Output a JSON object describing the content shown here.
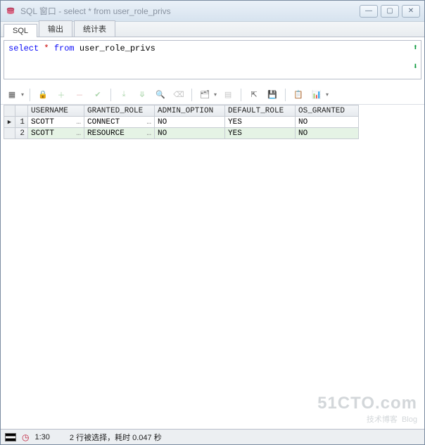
{
  "window": {
    "title": "SQL 窗口 - select * from user_role_privs"
  },
  "tabs": [
    {
      "label": "SQL",
      "active": true
    },
    {
      "label": "输出",
      "active": false
    },
    {
      "label": "统计表",
      "active": false
    }
  ],
  "sql": {
    "kw_select": "select",
    "star": "*",
    "kw_from": "from",
    "ident": "user_role_privs"
  },
  "columns": [
    "USERNAME",
    "GRANTED_ROLE",
    "ADMIN_OPTION",
    "DEFAULT_ROLE",
    "OS_GRANTED"
  ],
  "rows": [
    {
      "n": "1",
      "USERNAME": "SCOTT",
      "GRANTED_ROLE": "CONNECT",
      "ADMIN_OPTION": "NO",
      "DEFAULT_ROLE": "YES",
      "OS_GRANTED": "NO"
    },
    {
      "n": "2",
      "USERNAME": "SCOTT",
      "GRANTED_ROLE": "RESOURCE",
      "ADMIN_OPTION": "NO",
      "DEFAULT_ROLE": "YES",
      "OS_GRANTED": "NO"
    }
  ],
  "status": {
    "time": "1:30",
    "msg": "2 行被选择，耗时 0.047 秒"
  },
  "watermark": {
    "big": "51CTO.com",
    "sm1": "技术博客",
    "sm2": "Blog"
  }
}
